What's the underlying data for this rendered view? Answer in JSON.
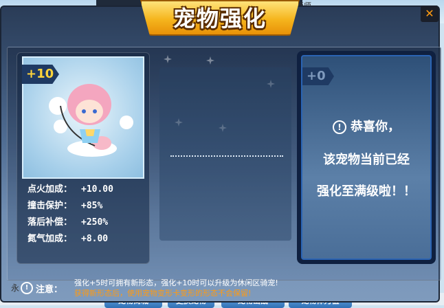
{
  "background": {
    "top_fragment": "运画师",
    "side_number": "2550",
    "left_char": "永",
    "bottom_buttons": [
      "宠物商城",
      "更换宠物",
      "宠物出战",
      "宠物体力值"
    ]
  },
  "dialog": {
    "title": "宠物强化",
    "close_icon": "✕"
  },
  "left_pet": {
    "level": "+10",
    "stats": [
      {
        "name": "点火加成：",
        "value": "+10.00"
      },
      {
        "name": "撞击保护：",
        "value": "+85%"
      },
      {
        "name": "落后补偿：",
        "value": "+250%"
      },
      {
        "name": "氮气加成：",
        "value": "+8.00"
      }
    ]
  },
  "right_pet": {
    "level": "+0",
    "message_line1": "恭喜你，",
    "message_line2": "该宠物当前已经",
    "message_line3": "强化至满级啦！！"
  },
  "notice": {
    "label": "注意：",
    "line1": "强化+5时可拥有新形态，强化+10时可以升级为休闲区骑宠!",
    "line2": "获得新形态后，使用宠物变形卡变形的形态不会保留!"
  },
  "colors": {
    "accent_orange": "#ff9b12",
    "level_gold": "#ffd43a",
    "panel_blue": "#2a64b4"
  }
}
